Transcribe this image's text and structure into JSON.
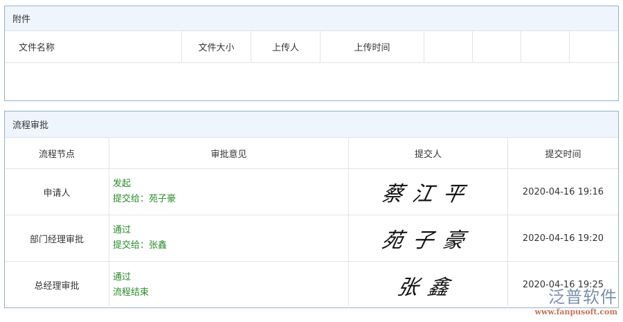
{
  "attachments": {
    "title": "附件",
    "columns": [
      "文件名称",
      "文件大小",
      "上传人",
      "上传时间",
      "",
      "",
      "",
      ""
    ]
  },
  "workflow": {
    "title": "流程审批",
    "columns": [
      "流程节点",
      "审批意见",
      "提交人",
      "提交时间"
    ],
    "rows": [
      {
        "node": "申请人",
        "opinion": "发起",
        "next": "提交给：苑子豪",
        "signature": "蔡江平",
        "time": "2020-04-16 19:16"
      },
      {
        "node": "部门经理审批",
        "opinion": "通过",
        "next": "提交给：张鑫",
        "signature": "苑子豪",
        "time": "2020-04-16 19:20"
      },
      {
        "node": "总经理审批",
        "opinion": "通过",
        "next": "流程结束",
        "signature": "张鑫",
        "time": "2020-04-16 19:25"
      }
    ]
  },
  "watermark": {
    "brand": "泛普软件",
    "url": "www.fanpusoft.com"
  }
}
